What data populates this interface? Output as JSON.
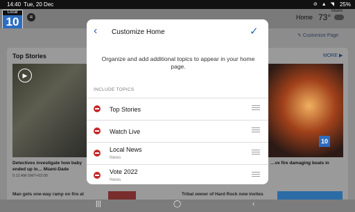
{
  "status_bar": {
    "time": "14:40",
    "date": "Tue, 20 Dec",
    "battery": "25%"
  },
  "header": {
    "logo_top": "Local",
    "logo_number": "10",
    "home_link": "Home",
    "temperature": "73°",
    "city": "Miami",
    "weather_icon": "cloud-icon"
  },
  "page": {
    "customize_link": "Customize Page",
    "section_title": "Top Stories",
    "more_link": "MORE",
    "stories": [
      {
        "headline": "Detectives investigate how baby ended up in… Miami-Dade",
        "time": "5:12 AM GMT+02:00"
      },
      {
        "headline": "…ve fire damaging boats in"
      },
      {
        "headline": "Man gets one-way ramp on fire at"
      },
      {
        "headline": "Tribal owner of Hard Rock now invites"
      }
    ],
    "badge": "10"
  },
  "modal": {
    "title": "Customize Home",
    "description": "Organize and add additional topics to appear in your home page.",
    "section_label": "INCLUDE TOPICS",
    "topics": [
      {
        "label": "Top Stories",
        "sub": ""
      },
      {
        "label": "Watch Live",
        "sub": ""
      },
      {
        "label": "Local News",
        "sub": "News"
      },
      {
        "label": "Vote 2022",
        "sub": "News"
      }
    ]
  },
  "colors": {
    "accent": "#2a62b8",
    "remove": "#c62828",
    "brand": "#2d6cc0"
  }
}
